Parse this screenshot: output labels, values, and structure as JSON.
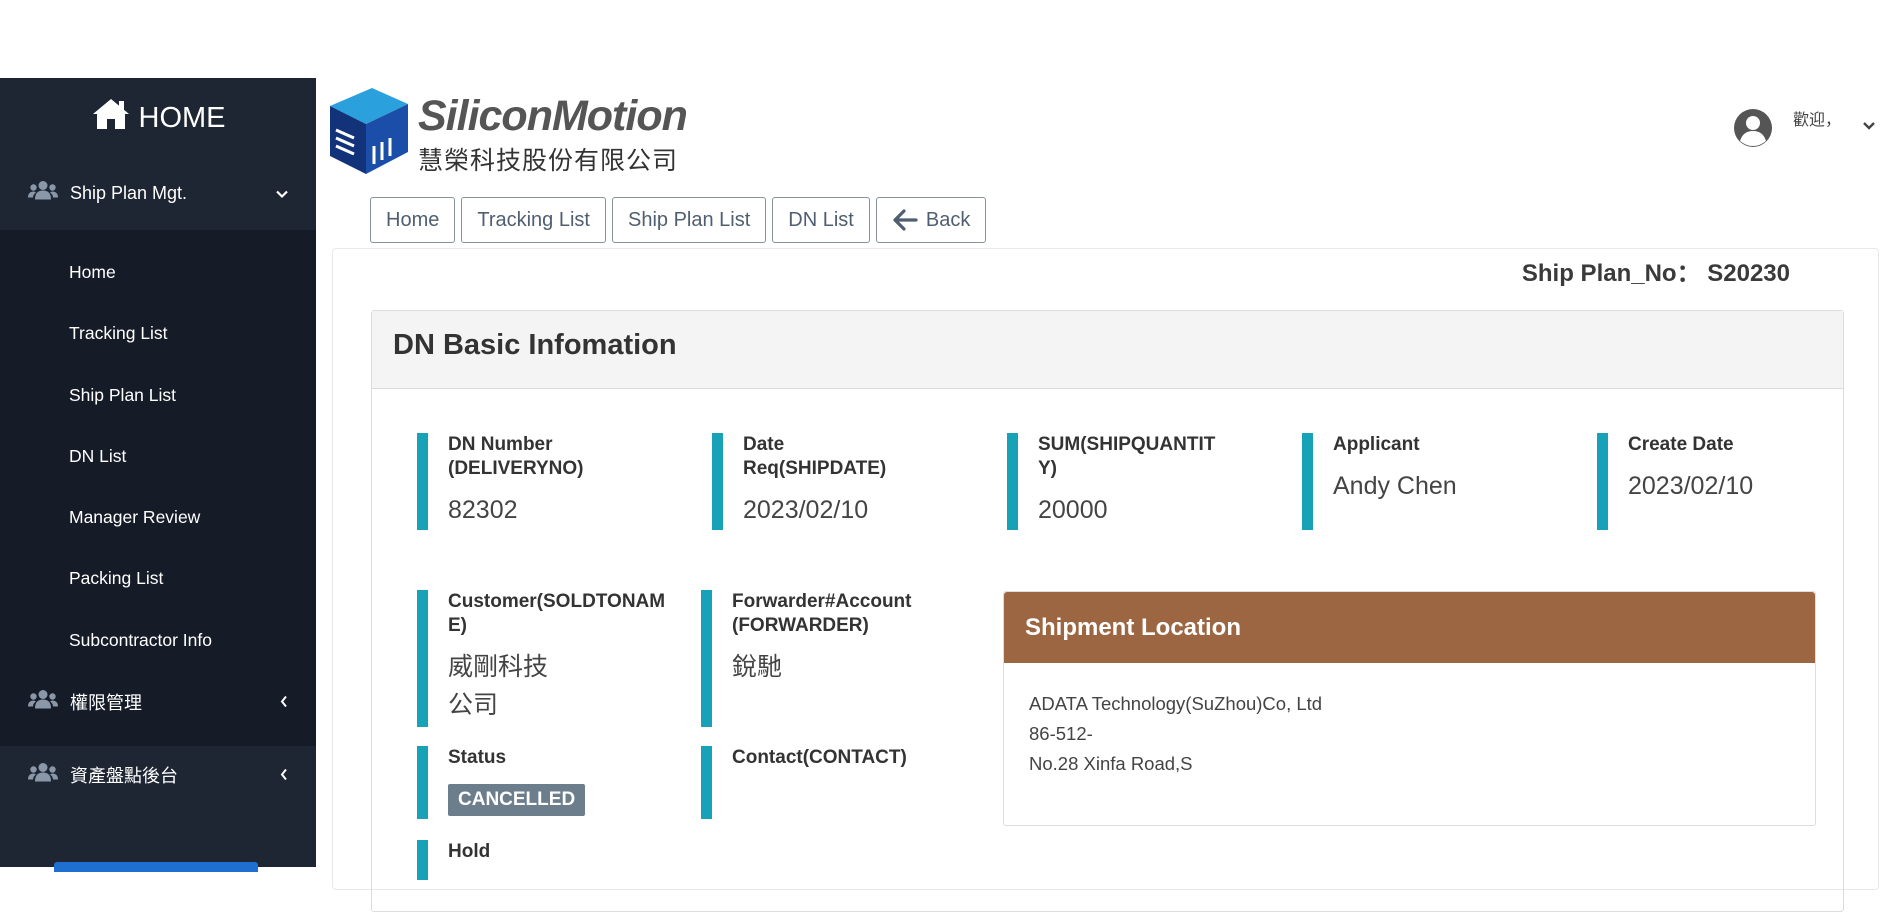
{
  "sidebar": {
    "home_label": "HOME",
    "groups": [
      {
        "label": "Ship Plan Mgt.",
        "icon": "users-icon",
        "expanded": true
      },
      {
        "label": "權限管理",
        "icon": "users-icon",
        "expanded": false
      },
      {
        "label": "資產盤點後台",
        "icon": "users-icon",
        "expanded": false
      }
    ],
    "items": [
      "Home",
      "Tracking List",
      "Ship Plan List",
      "DN List",
      "Manager Review",
      "Packing List",
      "Subcontractor Info"
    ]
  },
  "header": {
    "brand": "SiliconMotion",
    "brand_sub": "慧榮科技股份有限公司",
    "welcome": "歡迎，"
  },
  "nav_buttons": {
    "home": "Home",
    "tracking": "Tracking List",
    "ship_plan": "Ship Plan List",
    "dn_list": "DN List",
    "back": "Back"
  },
  "ship_plan_no": "Ship Plan_No： S20230",
  "dn_basic": {
    "title": "DN Basic Infomation",
    "dn_number_label": "DN Number (DELIVERYNO)",
    "dn_number": "82302",
    "date_req_label": "Date Req(SHIPDATE)",
    "date_req": "2023/02/10",
    "sum_label": "SUM(SHIPQUANTITY)",
    "sum": "20000",
    "applicant_label": "Applicant",
    "applicant": "Andy Chen",
    "create_date_label": "Create Date",
    "create_date": "2023/02/10",
    "customer_label": "Customer(SOLDTONAME)",
    "customer": "威剛科技公司",
    "forwarder_label": "Forwarder#Account (FORWARDER)",
    "forwarder": "銳馳",
    "status_label": "Status",
    "status": "CANCELLED",
    "contact_label": "Contact(CONTACT)",
    "hold_label": "Hold"
  },
  "shipment_location": {
    "title": "Shipment Location",
    "line1": "ADATA Technology(SuZhou)Co, Ltd",
    "line2": "86-512-",
    "line3": "No.28 Xinfa Road,S"
  },
  "colors": {
    "sidebar_bg": "#1e2533",
    "accent_bar": "#17a2b8",
    "location_header": "#9c6642",
    "status_badge": "#6c7d8c"
  }
}
